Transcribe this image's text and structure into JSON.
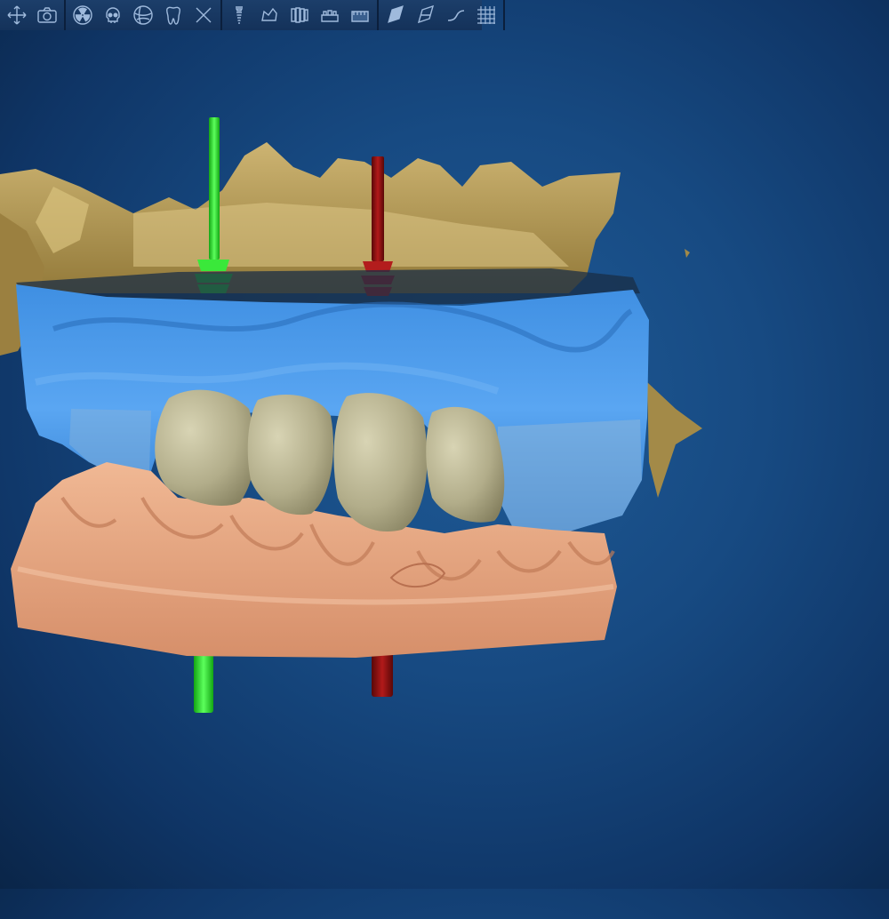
{
  "app": {
    "toolbar": {
      "groups": [
        {
          "name": "view",
          "buttons": [
            {
              "icon": "move-arrows-icon",
              "tooltip": ""
            },
            {
              "icon": "camera-icon",
              "tooltip": ""
            }
          ]
        },
        {
          "name": "display",
          "buttons": [
            {
              "icon": "radiation-icon",
              "tooltip": ""
            },
            {
              "icon": "skull-icon",
              "tooltip": ""
            },
            {
              "icon": "globe-jaw-icon",
              "tooltip": ""
            },
            {
              "icon": "tooth-icon",
              "tooltip": ""
            },
            {
              "icon": "close-x-icon",
              "tooltip": ""
            }
          ]
        },
        {
          "name": "models",
          "buttons": [
            {
              "icon": "implant-icon",
              "tooltip": ""
            },
            {
              "icon": "crown-icon",
              "tooltip": ""
            },
            {
              "icon": "teeth-row-icon",
              "tooltip": ""
            },
            {
              "icon": "jaw-model-icon",
              "tooltip": ""
            },
            {
              "icon": "lower-model-icon",
              "tooltip": ""
            }
          ]
        },
        {
          "name": "slices",
          "buttons": [
            {
              "icon": "slice-plane-filled-icon",
              "tooltip": ""
            },
            {
              "icon": "slice-plane-outline-icon",
              "tooltip": ""
            },
            {
              "icon": "curve-icon",
              "tooltip": ""
            },
            {
              "icon": "grid-icon",
              "tooltip": ""
            }
          ]
        }
      ]
    },
    "colors": {
      "bone": "#b49a55",
      "upper_model": "#3d8fe0",
      "lower_model": "#e2a27c",
      "crowns": "#b5b08e",
      "implant_green": "#22dd22",
      "implant_red": "#8e1010"
    }
  }
}
